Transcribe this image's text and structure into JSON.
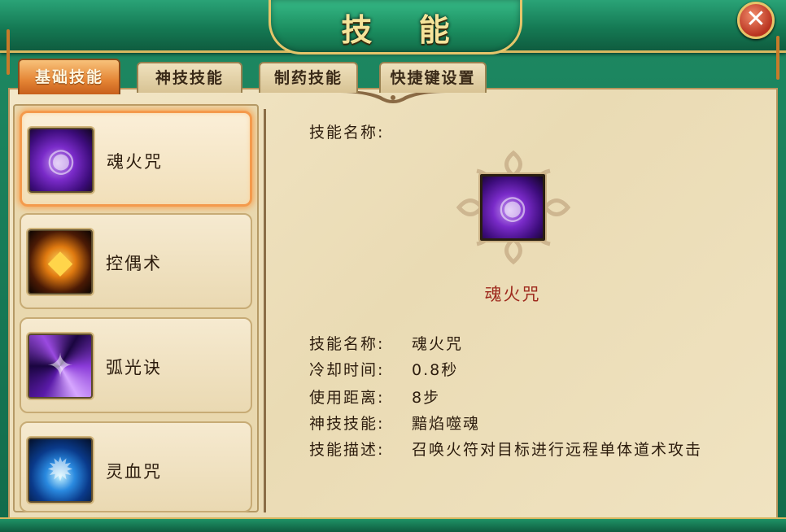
{
  "window": {
    "title": "技 能",
    "close_label": "✕"
  },
  "tabs": [
    {
      "label": "基础技能",
      "active": true
    },
    {
      "label": "神技技能",
      "active": false
    },
    {
      "label": "制药技能",
      "active": false
    },
    {
      "label": "快捷键设置",
      "active": false
    }
  ],
  "skills": [
    {
      "name": "魂火咒",
      "icon": "soul-fire-icon",
      "selected": true
    },
    {
      "name": "控偶术",
      "icon": "puppet-talisman-icon",
      "selected": false
    },
    {
      "name": "弧光诀",
      "icon": "arc-light-icon",
      "selected": false
    },
    {
      "name": "灵血咒",
      "icon": "spirit-blood-icon",
      "selected": false
    }
  ],
  "detail": {
    "header_label": "技能名称:",
    "icon": "soul-fire-icon",
    "name": "魂火咒",
    "rows": [
      {
        "label": "技能名称:",
        "value": "魂火咒"
      },
      {
        "label": "冷却时间:",
        "value": "0.8秒"
      },
      {
        "label": "使用距离:",
        "value": "8步"
      },
      {
        "label": "神技技能:",
        "value": "黯焰噬魂"
      },
      {
        "label": "技能描述:",
        "value": "召唤火符对目标进行远程单体道术攻击"
      }
    ]
  },
  "colors": {
    "frame_green": "#1e8a63",
    "gold_trim": "#d8b860",
    "active_tab": "#e48434",
    "skill_name_red": "#9e2a1e",
    "parchment": "#f0e3c1"
  }
}
